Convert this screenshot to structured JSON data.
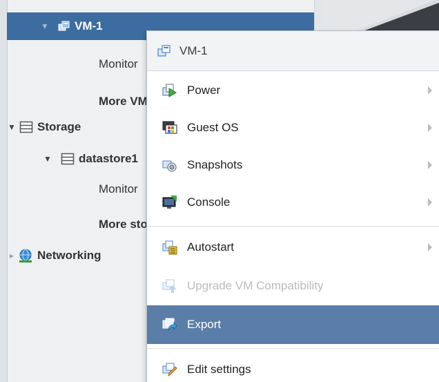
{
  "navigator": {
    "vm": {
      "label": "VM-1"
    },
    "vm_children": [
      {
        "label": "Monitor"
      },
      {
        "label": "More VMs..."
      }
    ],
    "storage": {
      "label": "Storage"
    },
    "datastore": {
      "label": "datastore1"
    },
    "datastore_children": [
      {
        "label": "Monitor"
      },
      {
        "label": "More storage..."
      }
    ],
    "networking": {
      "label": "Networking"
    }
  },
  "context_menu": {
    "header": "VM-1",
    "items": [
      {
        "label": "Power",
        "icon": "power-icon",
        "submenu": true
      },
      {
        "label": "Guest OS",
        "icon": "guest-os-icon",
        "submenu": true
      },
      {
        "label": "Snapshots",
        "icon": "snapshots-icon",
        "submenu": true
      },
      {
        "label": "Console",
        "icon": "console-icon",
        "submenu": true
      },
      {
        "label": "Autostart",
        "icon": "autostart-icon",
        "submenu": true
      },
      {
        "label": "Upgrade VM Compatibility",
        "icon": "upgrade-icon",
        "disabled": true
      },
      {
        "label": "Export",
        "icon": "export-icon",
        "highlighted": true
      },
      {
        "label": "Edit settings",
        "icon": "edit-settings-icon"
      }
    ]
  },
  "colors": {
    "selected_row": "#3d6ca0",
    "menu_highlight": "#5a7ea7",
    "navigator_bg": "#eef0f2"
  }
}
